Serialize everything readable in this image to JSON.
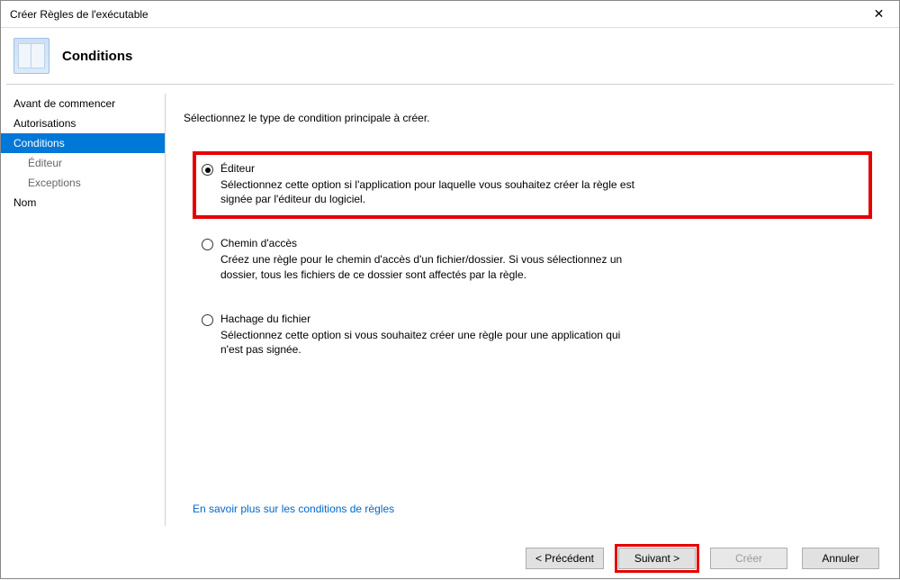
{
  "window": {
    "title": "Créer Règles de l'exécutable"
  },
  "header": {
    "title": "Conditions"
  },
  "sidebar": {
    "items": [
      {
        "label": "Avant de commencer",
        "selected": false,
        "sub": false
      },
      {
        "label": "Autorisations",
        "selected": false,
        "sub": false
      },
      {
        "label": "Conditions",
        "selected": true,
        "sub": false
      },
      {
        "label": "Éditeur",
        "selected": false,
        "sub": true
      },
      {
        "label": "Exceptions",
        "selected": false,
        "sub": true
      },
      {
        "label": "Nom",
        "selected": false,
        "sub": false
      }
    ]
  },
  "content": {
    "intro": "Sélectionnez le type de condition principale à créer.",
    "options": [
      {
        "title": "Éditeur",
        "desc": "Sélectionnez cette option si l'application pour laquelle vous souhaitez créer la règle est signée par l'éditeur du logiciel.",
        "checked": true,
        "highlighted": true
      },
      {
        "title": "Chemin d'accès",
        "desc": "Créez une règle pour le chemin d'accès d'un fichier/dossier. Si vous sélectionnez un dossier, tous les fichiers de ce dossier sont affectés par la règle.",
        "checked": false,
        "highlighted": false
      },
      {
        "title": "Hachage du fichier",
        "desc": "Sélectionnez cette option si vous souhaitez créer une règle pour une application qui n'est pas signée.",
        "checked": false,
        "highlighted": false
      }
    ],
    "learn_more": "En savoir plus sur les conditions de règles"
  },
  "buttons": {
    "back": "< Précédent",
    "next": "Suivant >",
    "create": "Créer",
    "cancel": "Annuler",
    "next_highlighted": true
  }
}
